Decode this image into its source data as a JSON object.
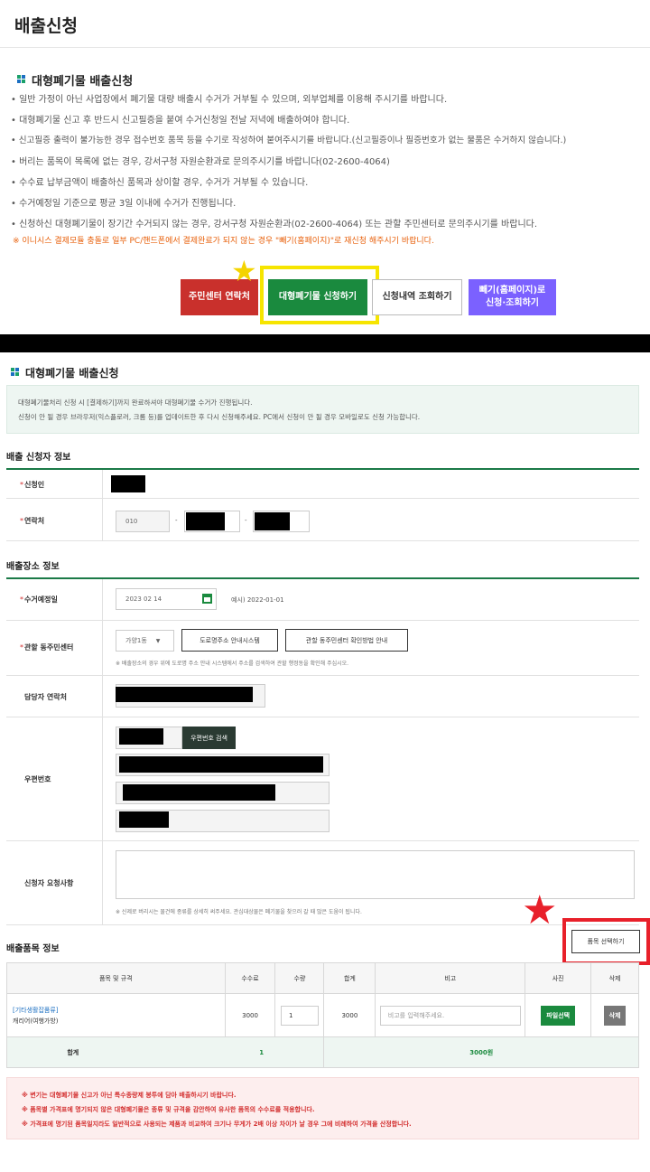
{
  "page": {
    "title": "배출신청"
  },
  "intro": {
    "heading": "대형폐기물 배출신청",
    "bullets": [
      "• 일반 가정이 아닌 사업장에서 폐기물 대량 배출시 수거가 거부될 수 있으며, 외부업체를 이용해 주시기를 바랍니다.",
      "• 대형폐기물 신고 후 반드시 신고필증을 붙여 수거신청일 전날 저녁에 배출하여야 합니다.",
      "• 신고필증 출력이 불가능한 경우 접수번호 품목 등을 수기로 작성하여 붙여주시기를 바랍니다.(신고필증이나 필증번호가 없는 물품은 수거하지 않습니다.)",
      "• 버리는 품목이 목록에 없는 경우, 강서구청 자원순환과로 문의주시기를 바랍니다(02-2600-4064)",
      "• 수수료 납부금액이 배출하신 품목과 상이할 경우, 수거가 거부될 수 있습니다.",
      "• 수거예정일 기준으로 평균 3일 이내에 수거가 진행됩니다.",
      "• 신청하신 대형폐기물이 장기간 수거되지 않는 경우, 강서구청 자원순환과(02-2600-4064) 또는 관할 주민센터로 문의주시기를 바랍니다."
    ],
    "warning": "※ 이니시스 결제모듈 충돌로 일부 PC/핸드폰에서 결제완료가 되지 않는 경우 \"빼기(홈페이지)\"로 재신청 해주시기 바랍니다."
  },
  "buttons": {
    "center_contact": "주민센터 연락처",
    "apply": "대형폐기물 신청하기",
    "history": "신청내역 조회하기",
    "web_line1": "빼기(홈페이지)로",
    "web_line2": "신청·조회하기"
  },
  "form": {
    "heading": "대형폐기물 배출신청",
    "info_lines": [
      "대형폐기물처리 신청 시 [결제하기]까지 완료하셔야 대형폐기물 수거가 진행됩니다.",
      "신청이 안 될 경우 브라우저(익스플로러, 크롬 등)를 업데이트한 후 다시 신청해주세요. PC에서 신청이 안 될 경우 모바일로도 신청 가능합니다."
    ],
    "applicant_section": "배출 신청자 정보",
    "applicant_label": "신청인",
    "contact_label": "연락처",
    "phone_prefix": "010",
    "place_section": "배출장소 정보",
    "date_label": "수거예정일",
    "date_value": "2023 02 14",
    "date_example": "예시) 2022-01-01",
    "district_label": "관할 동주민센터",
    "district_value": "가양1동",
    "road_btn": "도로명주소 안내시스템",
    "check_btn": "관할 동주민센터 확인방법 안내",
    "district_note": "※ 배출장소의 경우 위에 도로명 주소 안내 시스템에서 주소를 검색하여 관할 행정동을 확인해 주십시오.",
    "manager_label": "담당자 연락처",
    "postal_label": "우편번호",
    "postal_btn": "우편번호 검색",
    "request_label": "신청자 요청사항",
    "request_note": "※ 신제로 버리시는 물건에 종류를 상세히 써주세요. 관심대상물은 폐기물을 찾으러 갈 때 많은 도움이 됩니다.",
    "items_section": "배출품목 정보",
    "select_btn": "품목 선택하기"
  },
  "table": {
    "headers": [
      "품목 및 규격",
      "수수료",
      "수량",
      "합계",
      "비고",
      "사진",
      "삭제"
    ],
    "item_name": "[기타생활잡품류]",
    "item_spec": "캐리어(여행가방)",
    "fee": "3000",
    "qty": "1",
    "sum": "3000",
    "note_placeholder": "비고를 입력해주세요.",
    "photo_btn": "파일선택",
    "delete_btn": "삭제",
    "total_label": "합계",
    "total_qty": "1",
    "total_amount": "3000원"
  },
  "warnings": [
    "※ 변기는 대형폐기물 신고가 아닌 특수종량제 봉투에 담아 배출하시기 바랍니다.",
    "※ 품목별 가격표에 명기되지 않은 대형폐기물은 종류 및 규격을 감안하여 유사한 품목의 수수료를 적용합니다.",
    "※ 가격표에 명기된 품목일지라도 일반적으로 사용되는 제품과 비교하여 크기나 무게가 2배 이상 차이가 날 경우 그에 비례하여 가격을 산정합니다."
  ],
  "colors": {
    "red": "#c9302c",
    "green": "#1a8a3e",
    "purple": "#7b61ff",
    "highlight": "#f6e500",
    "red_box": "#e8202a"
  }
}
